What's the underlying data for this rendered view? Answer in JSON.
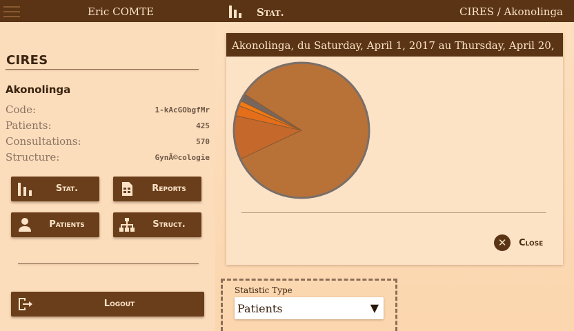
{
  "topbar": {
    "user_name": "Eric COMTE",
    "section_label": "Stat.",
    "location": "CIRES / Akonolinga"
  },
  "sidebar": {
    "org_title": "CIRES",
    "site_name": "Akonolinga",
    "info": [
      {
        "label": "Code:",
        "value": "1-kAcGObgfMr"
      },
      {
        "label": "Patients:",
        "value": "425"
      },
      {
        "label": "Consultations:",
        "value": "570"
      },
      {
        "label": "Structure:",
        "value": "GynÃ©cologie"
      }
    ],
    "buttons": {
      "stat": "Stat.",
      "reports": "Reports",
      "patients": "Patients",
      "struct": "Struct.",
      "logout": "Logout"
    }
  },
  "dialog": {
    "title": "Akonolinga, du Saturday, April 1, 2017 au Thursday, April 20,",
    "close_label": "Close"
  },
  "statistic": {
    "label": "Statistic Type",
    "selected": "Patients"
  },
  "chart_data": {
    "type": "pie",
    "slices": [
      {
        "value": 84.0,
        "color": "#b87238"
      },
      {
        "value": 10.5,
        "color": "#c4682c"
      },
      {
        "value": 2.5,
        "color": "#e46e1a"
      },
      {
        "value": 1.2,
        "color": "#f27a14"
      },
      {
        "value": 1.8,
        "color": "#76665e"
      }
    ]
  },
  "colors": {
    "header_bg": "#5a3414",
    "button_bg": "#6a3e1a",
    "page_bg": "#fbd6ae"
  }
}
